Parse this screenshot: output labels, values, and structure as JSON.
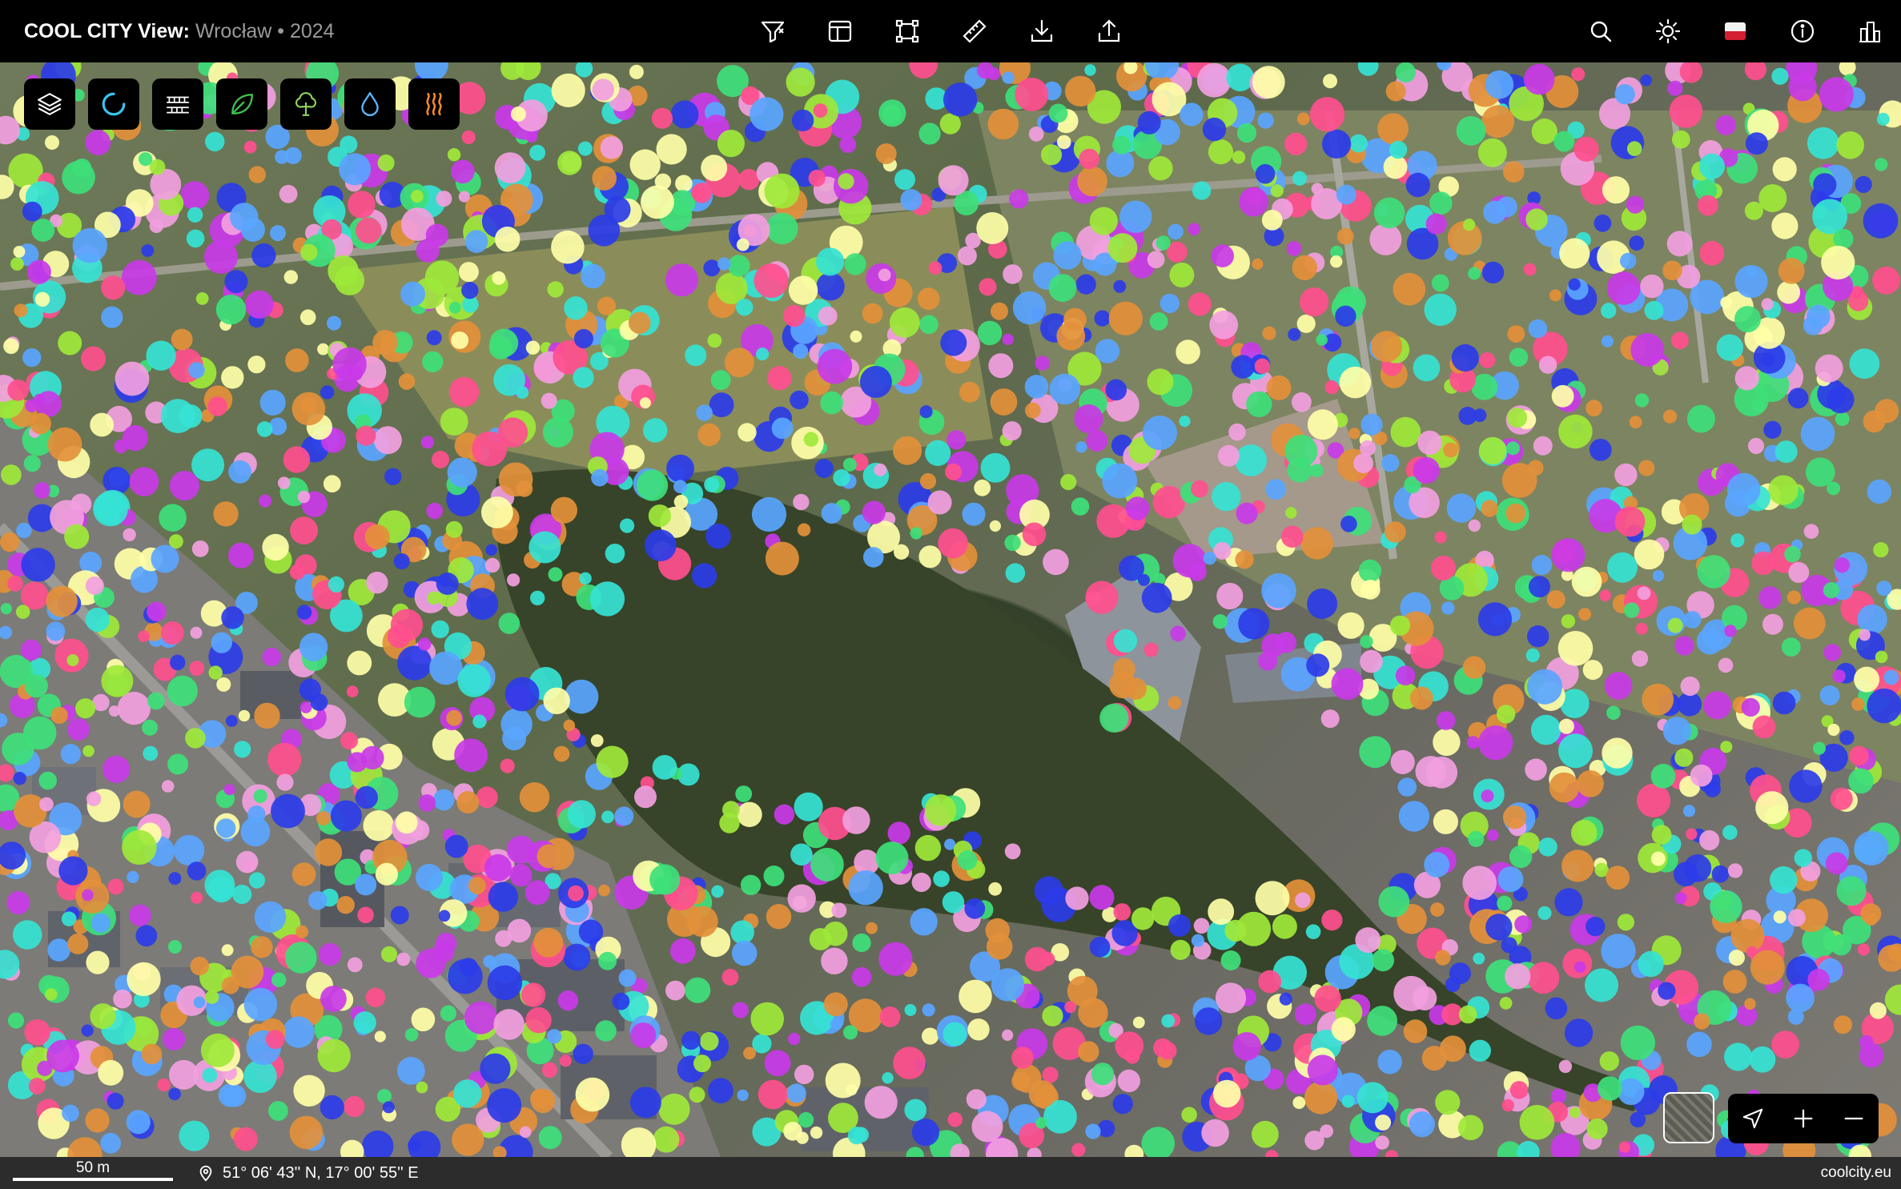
{
  "header": {
    "brand": "COOL CITY View:",
    "context": " Wrocław • 2024",
    "center_tools": [
      {
        "name": "filter-icon"
      },
      {
        "name": "layout-panel-icon"
      },
      {
        "name": "select-area-icon"
      },
      {
        "name": "ruler-icon"
      },
      {
        "name": "download-icon"
      },
      {
        "name": "share-icon"
      }
    ],
    "right_tools": [
      {
        "name": "search-icon"
      },
      {
        "name": "sun-icon"
      },
      {
        "name": "polish-flag-icon"
      },
      {
        "name": "info-icon"
      },
      {
        "name": "city-buildings-icon"
      }
    ]
  },
  "layers": [
    {
      "name": "layers-icon"
    },
    {
      "name": "spinner-icon"
    },
    {
      "name": "hatch-pattern-icon"
    },
    {
      "name": "leaf-icon"
    },
    {
      "name": "tree-icon"
    },
    {
      "name": "water-drop-icon"
    },
    {
      "name": "heat-waves-icon"
    }
  ],
  "map_controls": {
    "basemap": "satellite-basemap-thumbnail",
    "buttons": [
      "locate-arrow-icon",
      "zoom-in-icon",
      "zoom-out-icon"
    ]
  },
  "footer": {
    "scale_label": "50 m",
    "coordinates": "51° 06' 43'' N, 17° 00' 55'' E",
    "site": "coolcity.eu"
  },
  "colors": {
    "segment_palette": [
      "#e3903a",
      "#9ee83a",
      "#ff4f8e",
      "#5aa5ff",
      "#c93ae8",
      "#35e3d4",
      "#ffffa8",
      "#2b3ce8",
      "#3ee07a",
      "#f2a0e0"
    ],
    "water": "#374429",
    "topbar": "#000000",
    "footer": "#2c2c2c"
  }
}
